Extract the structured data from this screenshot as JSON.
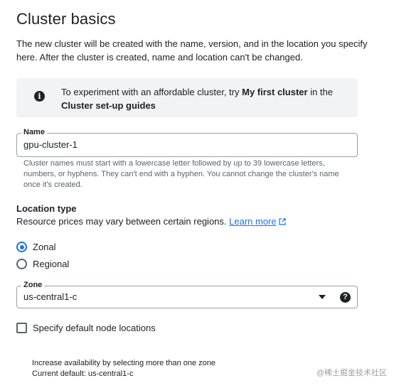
{
  "title": "Cluster basics",
  "intro": "The new cluster will be created with the name, version, and in the location you specify here. After the cluster is created, name and location can't be changed.",
  "info": {
    "icon": "info-icon",
    "prefix": "To experiment with an affordable cluster, try ",
    "link1": "My first cluster",
    "middle": " in the ",
    "link2": "Cluster set-up guides"
  },
  "name_field": {
    "label": "Name",
    "value": "gpu-cluster-1",
    "helper": "Cluster names must start with a lowercase letter followed by up to 39 lowercase letters, numbers, or hyphens. They can't end with a hyphen. You cannot change the cluster's name once it's created."
  },
  "location_type": {
    "heading": "Location type",
    "description": "Resource prices may vary between certain regions. ",
    "learn_more": "Learn more",
    "options": [
      {
        "label": "Zonal",
        "checked": true
      },
      {
        "label": "Regional",
        "checked": false
      }
    ]
  },
  "zone_field": {
    "label": "Zone",
    "value": "us-central1-c",
    "help_icon": "?"
  },
  "node_locations": {
    "label": "Specify default node locations",
    "checked": false,
    "note_line1": "Increase availability by selecting more than one zone",
    "note_line2": "Current default: us-central1-c"
  },
  "watermark": "@稀土掘金技术社区",
  "colors": {
    "accent": "#1a73e8",
    "text": "#202124",
    "muted": "#5f6368",
    "info_bg": "#f1f3f4"
  }
}
